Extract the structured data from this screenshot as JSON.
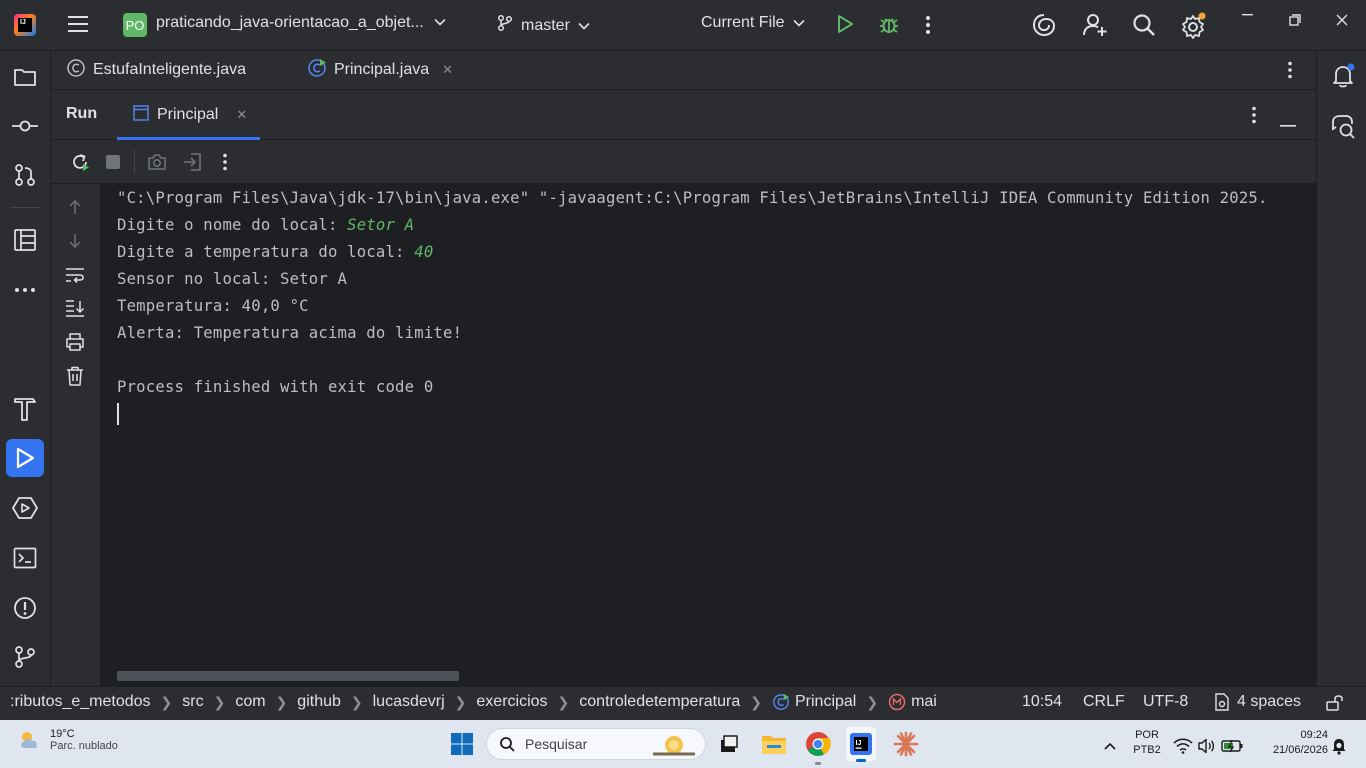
{
  "titlebar": {
    "project_badge": "PO",
    "project_name": "praticando_java-orientacao_a_objet...",
    "branch": "master",
    "run_config": "Current File"
  },
  "editor_tabs": [
    {
      "label": "EstufaInteligente.java"
    },
    {
      "label": "Principal.java"
    }
  ],
  "run_window": {
    "title": "Run",
    "tab_label": "Principal"
  },
  "console": {
    "lines": [
      {
        "text": "\"C:\\Program Files\\Java\\jdk-17\\bin\\java.exe\" \"-javaagent:C:\\Program Files\\JetBrains\\IntelliJ IDEA Community Edition 2025.",
        "input": ""
      },
      {
        "text": "Digite o nome do local: ",
        "input": "Setor A"
      },
      {
        "text": "Digite a temperatura do local: ",
        "input": "40"
      },
      {
        "text": "Sensor no local: Setor A",
        "input": ""
      },
      {
        "text": "Temperatura: 40,0 °C",
        "input": ""
      },
      {
        "text": "Alerta: Temperatura acima do limite!",
        "input": ""
      },
      {
        "text": "",
        "input": ""
      },
      {
        "text": "Process finished with exit code 0",
        "input": ""
      }
    ]
  },
  "statusbar": {
    "breadcrumbs": [
      ":ributos_e_metodos",
      "src",
      "com",
      "github",
      "lucasdevrj",
      "exercicios",
      "controledetemperatura",
      "Principal",
      "mai"
    ],
    "position": "10:54",
    "line_separator": "CRLF",
    "encoding": "UTF-8",
    "indent": "4 spaces"
  },
  "taskbar": {
    "weather_temp": "19°C",
    "weather_desc": "Parc. nublado",
    "search_placeholder": "Pesquisar",
    "language": "POR",
    "layout": "PTB2",
    "time": "09:24",
    "date": "21/06/2026"
  },
  "colors": {
    "accent": "#3574f0",
    "run_green": "#5fb865",
    "ide_bg": "#1e1f22",
    "panel_bg": "#2b2d30"
  }
}
